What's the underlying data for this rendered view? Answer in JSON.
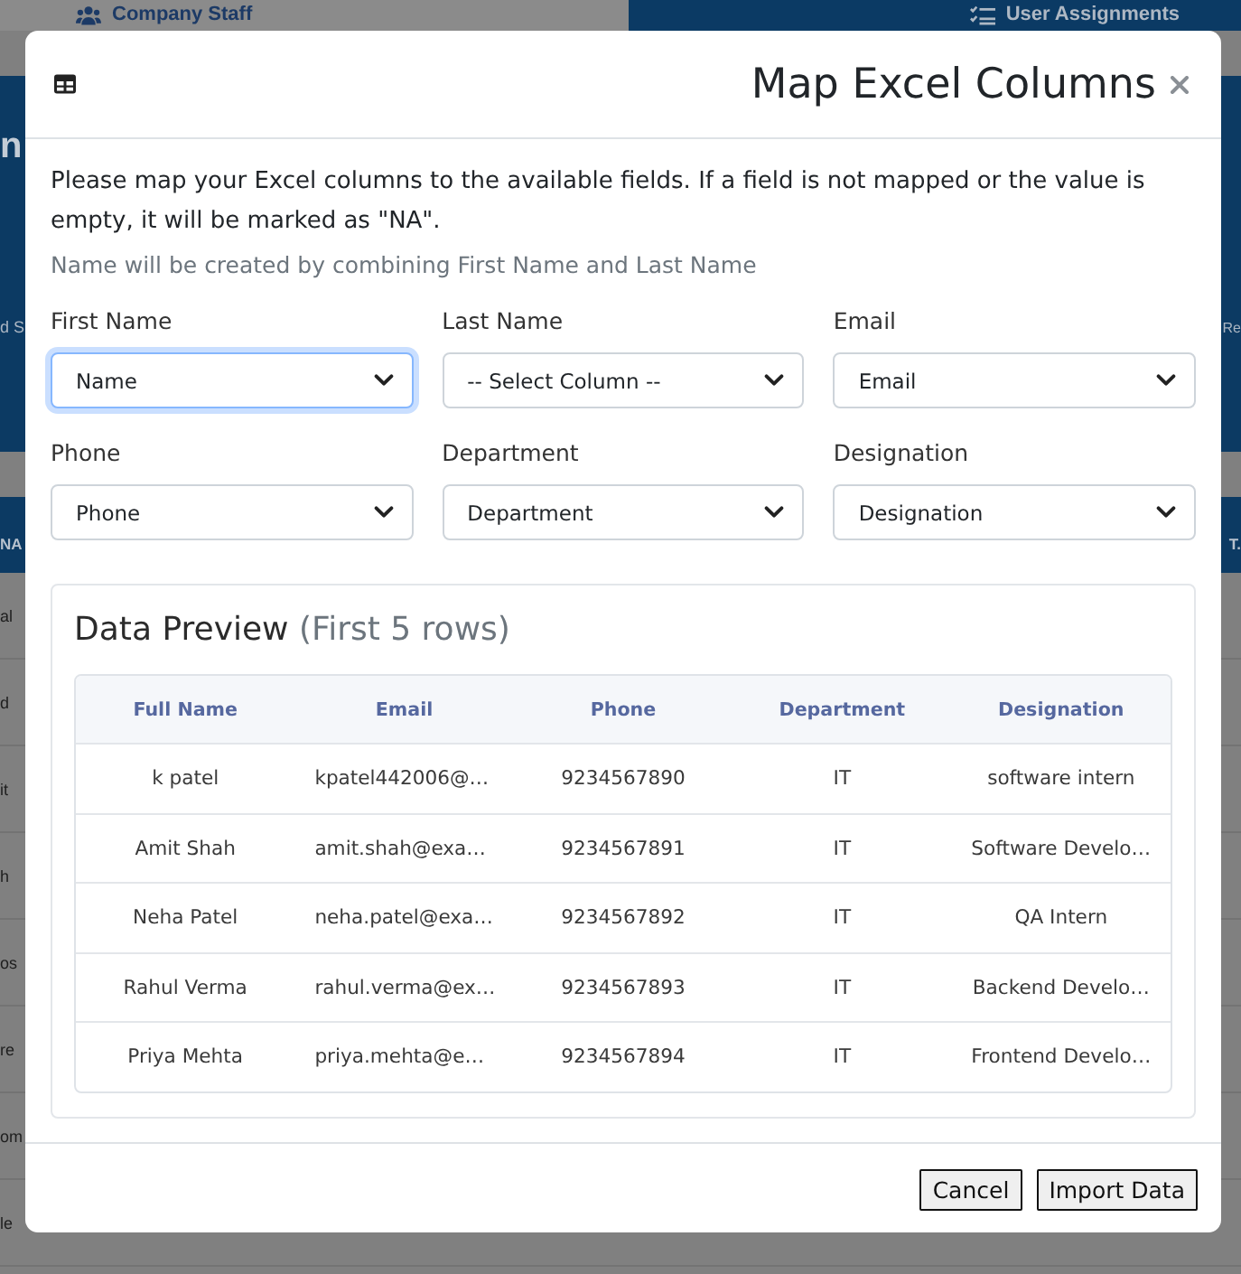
{
  "background_page": {
    "tabs": [
      {
        "label": "Company Staff",
        "selected": false
      },
      {
        "label": "User Assignments",
        "selected": true
      }
    ],
    "hero": {
      "title_fragment": "n",
      "toolbar_fragment": "d S",
      "toolbar_fragment_right": "Re"
    },
    "table_header": {
      "left_fragment": "NA",
      "right_fragment": "T."
    },
    "row_fragments": [
      "al",
      "d",
      "it",
      "h",
      "os",
      "re",
      "om",
      "le"
    ]
  },
  "modal": {
    "title": "Map Excel Columns",
    "instructions": "Please map your Excel columns to the available fields. If a field is not mapped or the value is empty, it will be marked as \"NA\".",
    "hint": "Name will be created by combining First Name and Last Name",
    "mappings": [
      {
        "label": "First Name",
        "value": "Name",
        "focused": true
      },
      {
        "label": "Last Name",
        "value": "-- Select Column --",
        "focused": false
      },
      {
        "label": "Email",
        "value": "Email",
        "focused": false
      },
      {
        "label": "Phone",
        "value": "Phone",
        "focused": false
      },
      {
        "label": "Department",
        "value": "Department",
        "focused": false
      },
      {
        "label": "Designation",
        "value": "Designation",
        "focused": false
      }
    ],
    "preview": {
      "title": "Data Preview",
      "subtitle": "(First 5 rows)",
      "columns": [
        "Full Name",
        "Email",
        "Phone",
        "Department",
        "Designation"
      ],
      "rows": [
        [
          "k patel",
          "kpatel442006@…",
          "9234567890",
          "IT",
          "software intern"
        ],
        [
          "Amit Shah",
          "amit.shah@exa…",
          "9234567891",
          "IT",
          "Software Develo…"
        ],
        [
          "Neha Patel",
          "neha.patel@exa…",
          "9234567892",
          "IT",
          "QA Intern"
        ],
        [
          "Rahul Verma",
          "rahul.verma@ex…",
          "9234567893",
          "IT",
          "Backend Develo…"
        ],
        [
          "Priya Mehta",
          "priya.mehta@e…",
          "9234567894",
          "IT",
          "Frontend Develo…"
        ]
      ]
    },
    "buttons": [
      "Cancel",
      "Import Data"
    ]
  }
}
